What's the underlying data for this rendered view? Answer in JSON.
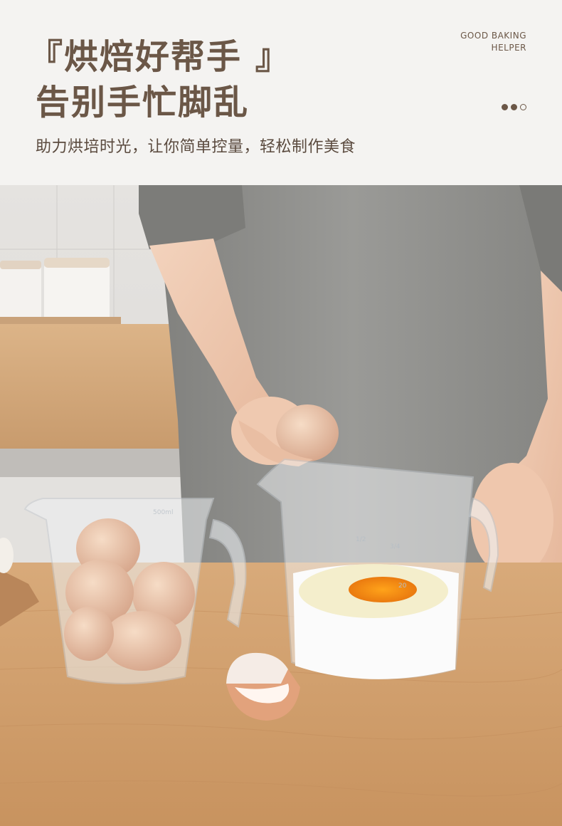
{
  "header": {
    "title_line1": "『烘焙好帮手 』",
    "title_line2": "告别手忙脚乱",
    "tag_en_line1": "GOOD BAKING",
    "tag_en_line2": "HELPER",
    "subtitle": "助力烘培时光，让你简单控量，轻松制作美食"
  },
  "colors": {
    "brown_text": "#6b5747",
    "header_bg": "#f4f3f1",
    "counter_wood": "#d9a978",
    "apron_gray": "#8f8f8c"
  },
  "photo": {
    "icon": "baking-scene-illustration",
    "jug_marks": [
      "500ml",
      "1/2",
      "20",
      "3/4"
    ]
  }
}
